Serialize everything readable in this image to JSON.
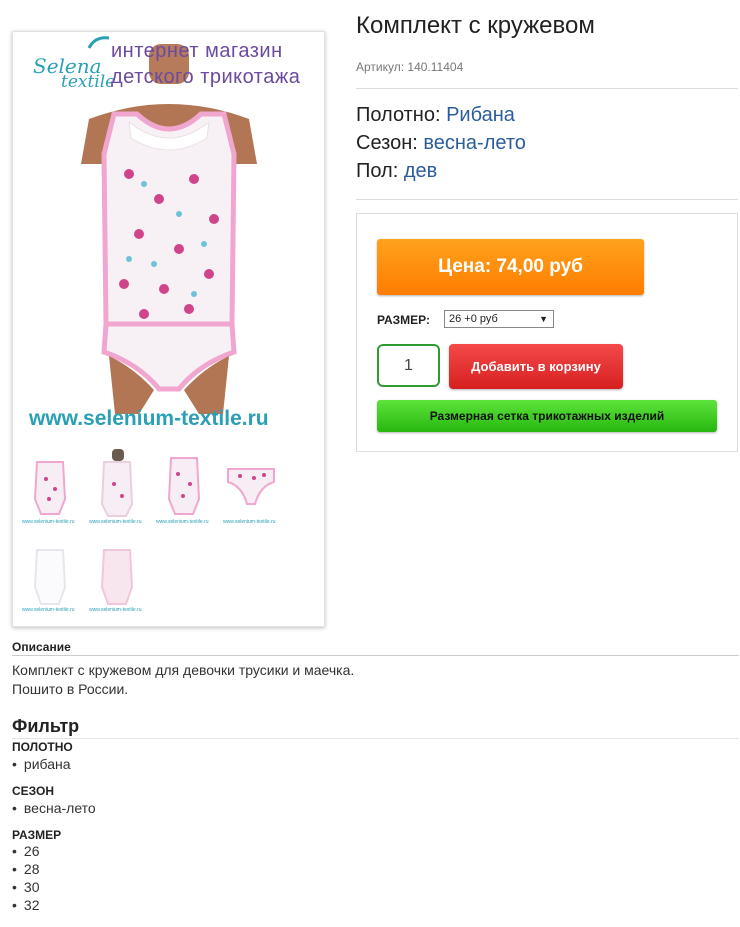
{
  "product": {
    "title": "Комплект с кружевом",
    "sku": "Артикул: 140.11404",
    "attributes": [
      {
        "label": "Полотно:",
        "value": "Рибана"
      },
      {
        "label": "Сезон:",
        "value": "весна-лето"
      },
      {
        "label": "Пол:",
        "value": "дев"
      }
    ]
  },
  "image": {
    "logo_word1": "Selena",
    "logo_word2": "textile",
    "logo_line1": "интернет магазин",
    "logo_line2": "детского трикотажа",
    "site_url": "www.selenium-textile.ru",
    "thumb_caption": "интернет магазин детского трикотажа",
    "thumb_url": "www.selenium-textile.ru"
  },
  "buy": {
    "price": "Цена: 74,00 руб",
    "size_label": "РАЗМЕР:",
    "size_selected": "26 +0 руб",
    "quantity": "1",
    "add_to_cart": "Добавить в корзину",
    "size_chart": "Размерная сетка трикотажных изделий"
  },
  "description": {
    "heading": "Описание",
    "line1": "Комплект с кружевом для девочки трусики и маечка.",
    "line2": "Пошито в России."
  },
  "filter": {
    "heading": "Фильтр",
    "fabric_label": "ПОЛОТНО",
    "fabric_items": [
      "рибана"
    ],
    "season_label": "СЕЗОН",
    "season_items": [
      "весна-лето"
    ],
    "size_label": "РАЗМЕР",
    "size_items": [
      "26",
      "28",
      "30",
      "32"
    ]
  },
  "colors": {
    "price_orange": "#ff8a0d",
    "cart_red": "#e53030",
    "chart_green": "#3fcf25",
    "link_blue": "#2a5d9a"
  }
}
